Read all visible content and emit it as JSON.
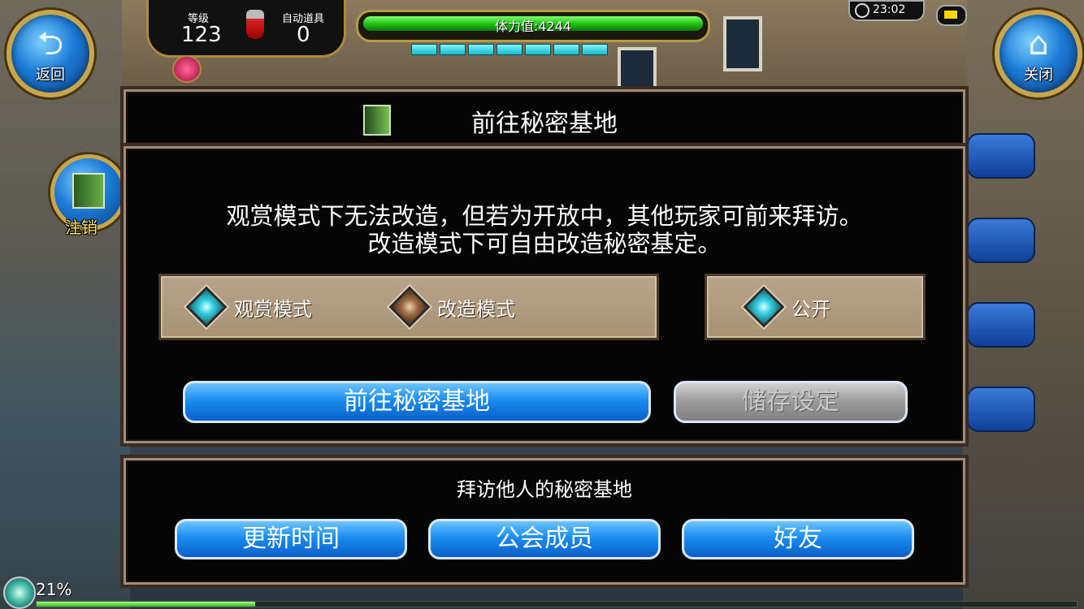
{
  "hud": {
    "back_label": "返回",
    "close_label": "关闭",
    "logout_label": "注销",
    "level_label": "等级",
    "level_value": "123",
    "auto_item_label": "自动道具",
    "auto_item_value": "0",
    "stamina_text": "体力值:4244",
    "stamina_fraction": 1.0,
    "stamina_segments": 7,
    "time": "23:02",
    "exp_percent_text": "21%",
    "exp_fraction": 0.21
  },
  "dialog": {
    "title": "前往秘密基地",
    "description_line1": "观赏模式下无法改造，但若为开放中，其他玩家可前来拜访。",
    "description_line2": "改造模式下可自由改造秘密基定。",
    "modes": [
      {
        "label": "观赏模式",
        "selected": true
      },
      {
        "label": "改造模式",
        "selected": false
      }
    ],
    "public_option": {
      "label": "公开",
      "selected": true
    },
    "go_button": "前往秘密基地",
    "save_button": "储存设定"
  },
  "visit": {
    "title": "拜访他人的秘密基地",
    "buttons": [
      "更新时间",
      "公会成员",
      "好友"
    ]
  },
  "colors": {
    "accent_blue": "#1a8cf0",
    "frame_gold": "#c8a64c",
    "stamina_green": "#22c418"
  }
}
